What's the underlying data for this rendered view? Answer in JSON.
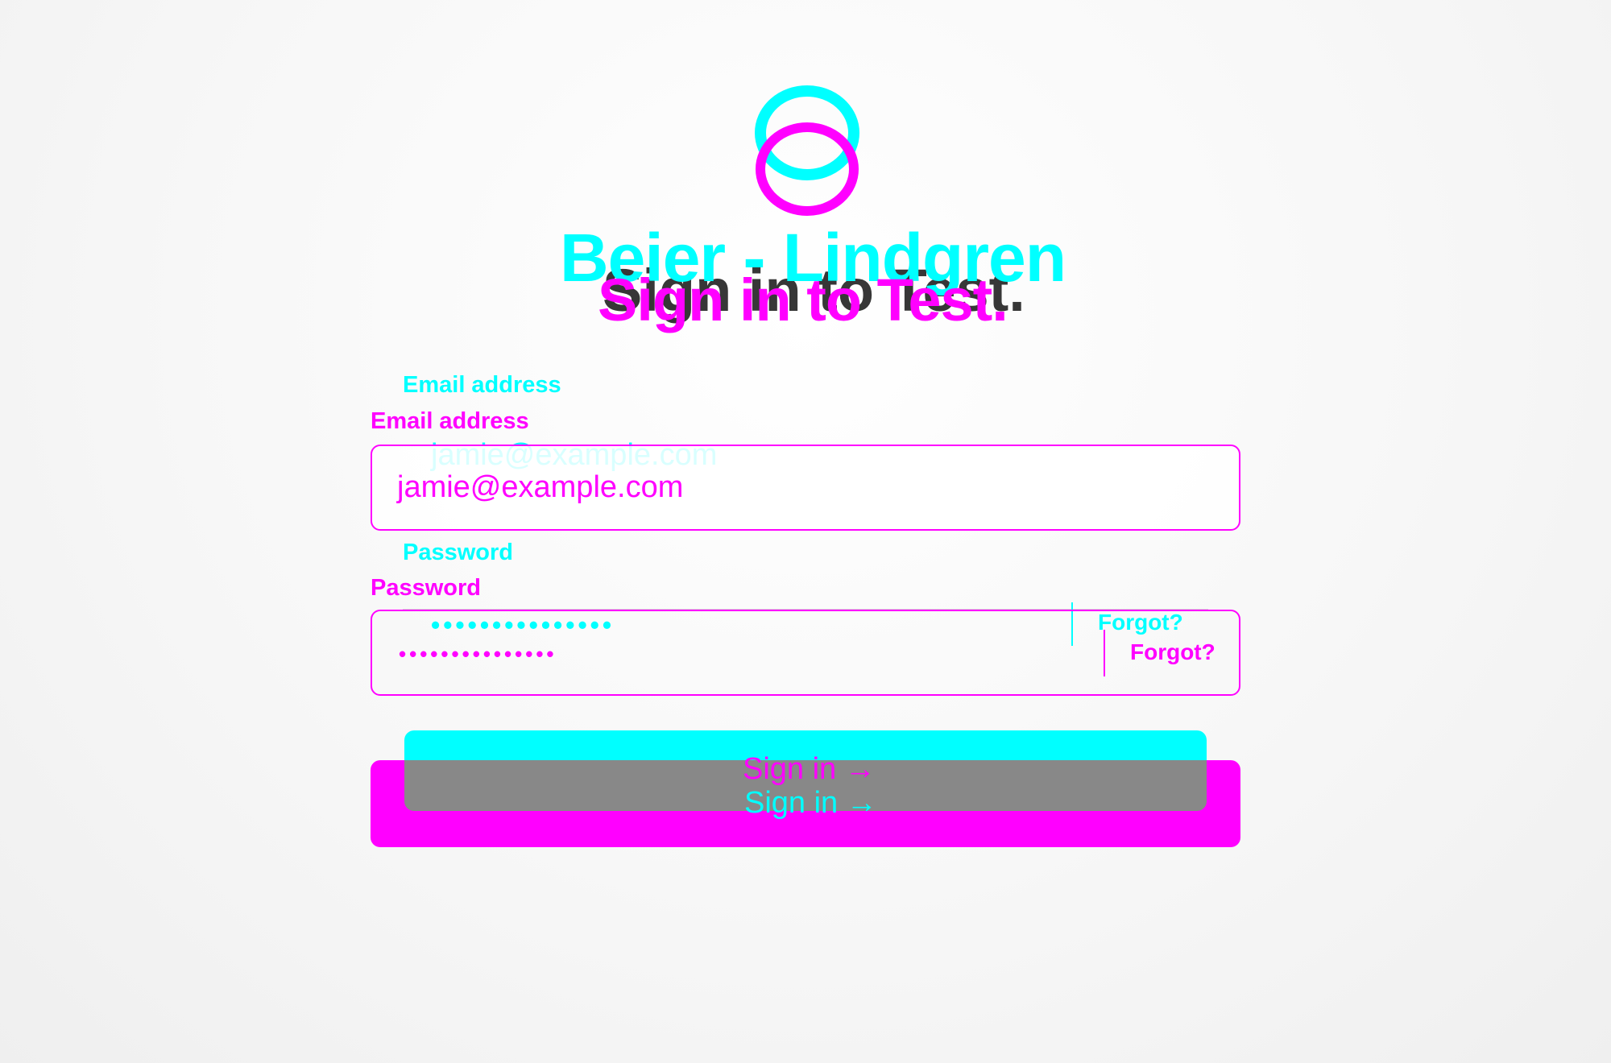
{
  "colors": {
    "cyan": "#00ffff",
    "magenta": "#ff00ff",
    "gray_overlay": "#888888"
  },
  "logo": {
    "icon": "interlocking-rings-logo-icon"
  },
  "brand": {
    "name": "Beier - Lindgren"
  },
  "page": {
    "title": "Sign in to Test."
  },
  "form": {
    "email_label": "Email address",
    "email_value": "jamie@example.com",
    "password_label": "Password",
    "password_mask_cyan": "•••••••••••••••",
    "password_mask_magenta": "•••••••••••••••",
    "forgot_label": "Forgot?",
    "submit_label": "Sign in →"
  }
}
